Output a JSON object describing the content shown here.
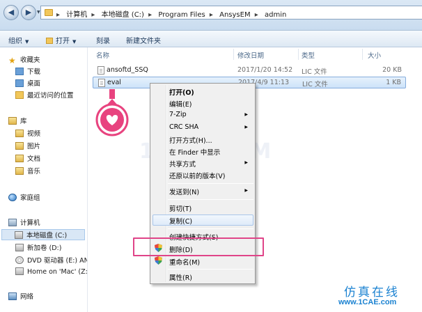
{
  "address_bar": {
    "crumbs": [
      "计算机",
      "本地磁盘 (C:)",
      "Program Files",
      "AnsysEM",
      "admin"
    ]
  },
  "toolbar": {
    "organize": "组织",
    "open": "打开",
    "burn": "刻录",
    "new_folder": "新建文件夹"
  },
  "nav_pane": {
    "favorites": "收藏夹",
    "favorites_items": [
      "下载",
      "桌面",
      "最近访问的位置"
    ],
    "libraries": "库",
    "library_items": [
      "视频",
      "图片",
      "文档",
      "音乐"
    ],
    "homegroup": "家庭组",
    "computer": "计算机",
    "computer_items": [
      "本地磁盘 (C:)",
      "新加卷 (D:)",
      "DVD 驱动器 (E:) AN",
      "Home on 'Mac' (Z:"
    ],
    "network": "网络"
  },
  "columns": {
    "name": "名称",
    "date": "修改日期",
    "type": "类型",
    "size": "大小"
  },
  "files": [
    {
      "name": "ansoftd_SSQ",
      "date": "2017/1/20 14:52",
      "type": "LIC 文件",
      "size": "20 KB"
    },
    {
      "name": "eval",
      "date": "2017/4/9 11:13",
      "type": "LIC 文件",
      "size": "1 KB"
    }
  ],
  "context_menu": {
    "open": "打开(O)",
    "edit": "编辑(E)",
    "zip": "7-Zip",
    "crc": "CRC SHA",
    "open_with": "打开方式(H)...",
    "show_in_finder": "在 Finder 中显示",
    "share": "共享方式",
    "restore": "还原以前的版本(V)",
    "send_to": "发送到(N)",
    "cut": "剪切(T)",
    "copy": "复制(C)",
    "create_shortcut": "创建快捷方式(S)",
    "delete": "删除(D)",
    "rename": "重命名(M)",
    "properties": "属性(R)"
  },
  "watermark": "1CAE.COM",
  "brand": {
    "cn": "仿真在线",
    "url": "www.1CAE.com"
  },
  "colors": {
    "highlight": "#e04488",
    "marker": "#e8437f",
    "brand": "#1b82d1"
  }
}
